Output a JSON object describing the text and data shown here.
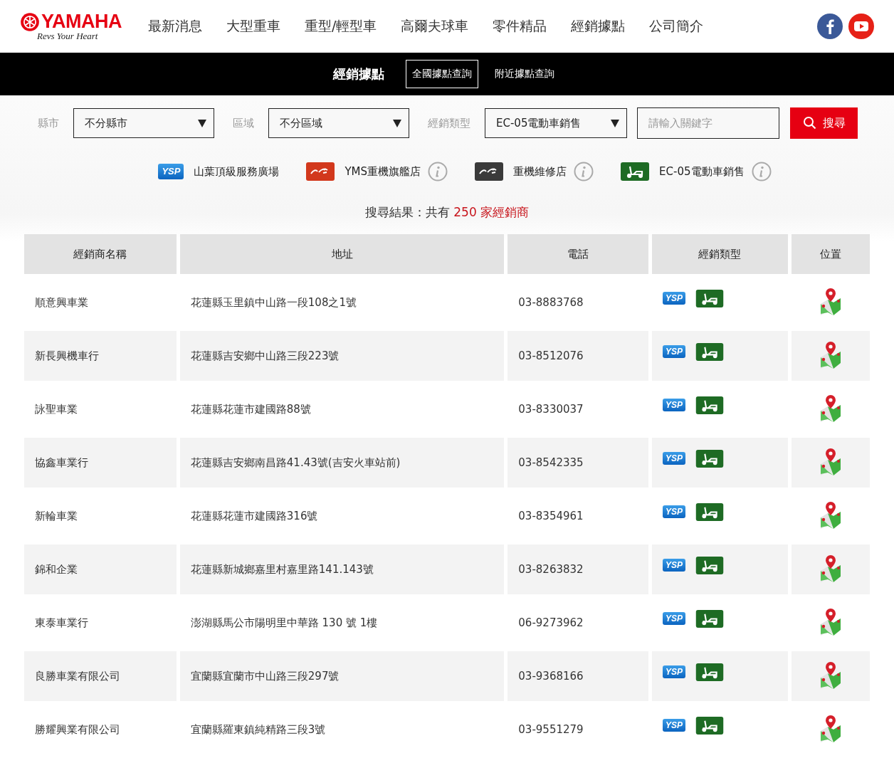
{
  "header": {
    "logo": {
      "brand": "YAMAHA",
      "tagline": "Revs Your Heart"
    },
    "nav": [
      "最新消息",
      "大型重車",
      "重型/輕型車",
      "高爾夫球車",
      "零件精品",
      "經銷據點",
      "公司簡介"
    ]
  },
  "subnav": {
    "title": "經銷據點",
    "tabs": [
      {
        "label": "全國據點查詢",
        "selected": true
      },
      {
        "label": "附近據點查詢",
        "selected": false
      }
    ]
  },
  "filters": {
    "fields": [
      {
        "label": "縣市",
        "value": "不分縣市"
      },
      {
        "label": "區域",
        "value": "不分區域"
      },
      {
        "label": "經銷類型",
        "value": "EC-05電動車銷售"
      }
    ],
    "search": {
      "placeholder": "請輸入關鍵字"
    },
    "button": "搜尋"
  },
  "legend": [
    {
      "kind": "ysp",
      "badge": "YSP",
      "label": "山葉頂級服務廣場",
      "info": false
    },
    {
      "kind": "yms",
      "label": "YMS重機旗艦店",
      "info": true
    },
    {
      "kind": "repair",
      "label": "重機維修店",
      "info": true
    },
    {
      "kind": "ec05",
      "label": "EC-05電動車銷售",
      "info": true
    }
  ],
  "result": {
    "prefix": "搜尋結果：共有",
    "count": "250 家經銷商"
  },
  "table": {
    "columns": [
      "經銷商名稱",
      "地址",
      "電話",
      "經銷類型",
      "位置"
    ],
    "rows": [
      {
        "name": "順意興車業",
        "address": "花蓮縣玉里鎮中山路一段108之1號",
        "phone": "03-8883768",
        "types": [
          {
            "kind": "ysp",
            "badge": "YSP"
          },
          {
            "kind": "ec05"
          }
        ]
      },
      {
        "name": "新長興機車行",
        "address": "花蓮縣吉安鄉中山路三段223號",
        "phone": "03-8512076",
        "types": [
          {
            "kind": "ysp",
            "badge": "YSP"
          },
          {
            "kind": "ec05"
          }
        ]
      },
      {
        "name": "詠聖車業",
        "address": "花蓮縣花蓮市建國路88號",
        "phone": "03-8330037",
        "types": [
          {
            "kind": "ysp",
            "badge": "YSP"
          },
          {
            "kind": "ec05"
          }
        ]
      },
      {
        "name": "協鑫車業行",
        "address": "花蓮縣吉安鄉南昌路41.43號(吉安火車站前)",
        "phone": "03-8542335",
        "types": [
          {
            "kind": "ysp",
            "badge": "YSP"
          },
          {
            "kind": "ec05"
          }
        ]
      },
      {
        "name": "新輪車業",
        "address": "花蓮縣花蓮市建國路316號",
        "phone": "03-8354961",
        "types": [
          {
            "kind": "ysp",
            "badge": "YSP"
          },
          {
            "kind": "ec05"
          }
        ]
      },
      {
        "name": "錦和企業",
        "address": "花蓮縣新城鄉嘉里村嘉里路141.143號",
        "phone": "03-8263832",
        "types": [
          {
            "kind": "ysp",
            "badge": "YSP"
          },
          {
            "kind": "ec05"
          }
        ]
      },
      {
        "name": "東泰車業行",
        "address": "澎湖縣馬公市陽明里中華路 130 號 1樓",
        "phone": "06-9273962",
        "types": [
          {
            "kind": "ysp",
            "badge": "YSP"
          },
          {
            "kind": "ec05"
          }
        ]
      },
      {
        "name": "良勝車業有限公司",
        "address": "宜蘭縣宜蘭市中山路三段297號",
        "phone": "03-9368166",
        "types": [
          {
            "kind": "ysp",
            "badge": "YSP"
          },
          {
            "kind": "ec05"
          }
        ]
      },
      {
        "name": "勝耀興業有限公司",
        "address": "宜蘭縣羅東鎮純精路三段3號",
        "phone": "03-9551279",
        "types": [
          {
            "kind": "ysp",
            "badge": "YSP"
          },
          {
            "kind": "ec05"
          }
        ]
      }
    ]
  }
}
